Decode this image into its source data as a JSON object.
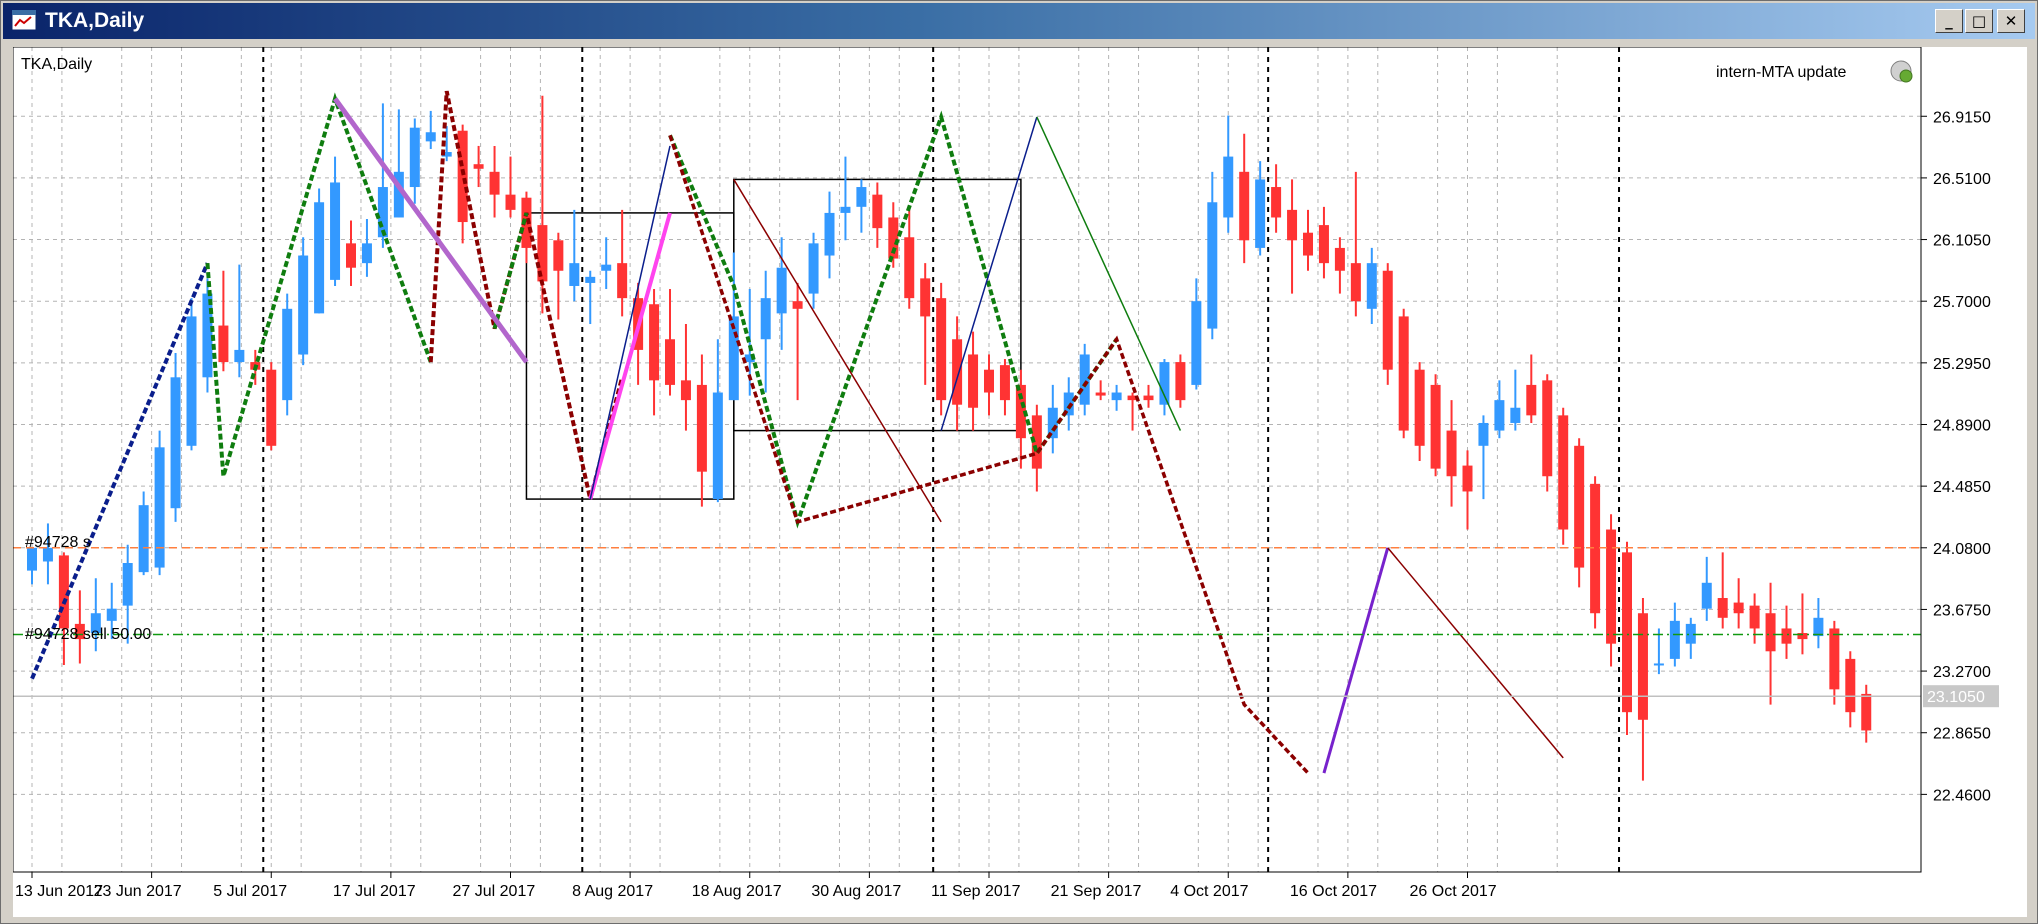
{
  "window": {
    "title": "TKA,Daily"
  },
  "chart_overlay": {
    "symbol_label": "TKA,Daily",
    "expert_label": "intern-MTA update",
    "order_label": "#94728 s",
    "order_line_label": "#94728 sell 50.00",
    "current_price_label": "23.1050"
  },
  "colors": {
    "bull": "#3399ff",
    "bear": "#ff3333",
    "grid": "#b4b4b4",
    "zigzag_dark_blue": "#0a1e8c",
    "zigzag_green": "#0f7d0f",
    "zigzag_dark_red": "#8b0000",
    "trend_purple": "#b266cc",
    "trend_magenta": "#ff44ee",
    "trend_violet": "#7722cc",
    "order_line": "#ff7f3f",
    "sell_line": "#119911",
    "price_line": "#c0c0c0"
  },
  "chart_data": {
    "type": "candlestick",
    "title": "TKA,Daily",
    "y_ticks": [
      "26.9150",
      "26.5100",
      "26.1050",
      "25.7000",
      "25.2950",
      "24.8900",
      "24.4850",
      "24.0800",
      "23.6750",
      "23.2700",
      "22.8650",
      "22.4600"
    ],
    "x_ticks": [
      "13 Jun 2017",
      "23 Jun 2017",
      "5 Jul 2017",
      "17 Jul 2017",
      "27 Jul 2017",
      "8 Aug 2017",
      "18 Aug 2017",
      "30 Aug 2017",
      "11 Sep 2017",
      "21 Sep 2017",
      "4 Oct 2017",
      "16 Oct 2017",
      "26 Oct 2017"
    ],
    "ylim": [
      21.95,
      27.37
    ],
    "grid": true,
    "horizontal_levels": [
      {
        "name": "order",
        "value": 24.08
      },
      {
        "name": "sell",
        "value": 23.51
      },
      {
        "name": "current",
        "value": 23.105
      }
    ],
    "candles": [
      {
        "o": 23.93,
        "h": 24.04,
        "l": 23.84,
        "c": 24.08
      },
      {
        "o": 23.99,
        "h": 24.24,
        "l": 23.84,
        "c": 24.08
      },
      {
        "o": 24.03,
        "h": 24.05,
        "l": 23.31,
        "c": 23.55
      },
      {
        "o": 23.58,
        "h": 23.8,
        "l": 23.32,
        "c": 23.48
      },
      {
        "o": 23.52,
        "h": 23.88,
        "l": 23.4,
        "c": 23.65
      },
      {
        "o": 23.6,
        "h": 23.85,
        "l": 23.48,
        "c": 23.68
      },
      {
        "o": 23.7,
        "h": 24.1,
        "l": 23.45,
        "c": 23.98
      },
      {
        "o": 23.92,
        "h": 24.45,
        "l": 23.9,
        "c": 24.36
      },
      {
        "o": 23.95,
        "h": 24.85,
        "l": 23.9,
        "c": 24.74
      },
      {
        "o": 24.34,
        "h": 25.36,
        "l": 24.25,
        "c": 25.2
      },
      {
        "o": 24.75,
        "h": 25.72,
        "l": 24.72,
        "c": 25.6
      },
      {
        "o": 25.2,
        "h": 25.85,
        "l": 25.1,
        "c": 25.75
      },
      {
        "o": 25.54,
        "h": 25.9,
        "l": 25.24,
        "c": 25.3
      },
      {
        "o": 25.3,
        "h": 25.94,
        "l": 25.2,
        "c": 25.38
      },
      {
        "o": 25.3,
        "h": 25.38,
        "l": 25.15,
        "c": 25.25
      },
      {
        "o": 25.25,
        "h": 25.3,
        "l": 24.72,
        "c": 24.75
      },
      {
        "o": 25.05,
        "h": 25.75,
        "l": 24.95,
        "c": 25.65
      },
      {
        "o": 25.35,
        "h": 26.12,
        "l": 25.28,
        "c": 26.0
      },
      {
        "o": 25.62,
        "h": 26.44,
        "l": 25.62,
        "c": 26.35
      },
      {
        "o": 25.84,
        "h": 26.65,
        "l": 25.8,
        "c": 26.48
      },
      {
        "o": 26.08,
        "h": 26.23,
        "l": 25.8,
        "c": 25.92
      },
      {
        "o": 25.95,
        "h": 26.24,
        "l": 25.86,
        "c": 26.08
      },
      {
        "o": 26.12,
        "h": 27.0,
        "l": 26.05,
        "c": 26.45
      },
      {
        "o": 26.25,
        "h": 26.96,
        "l": 26.25,
        "c": 26.55
      },
      {
        "o": 26.45,
        "h": 26.9,
        "l": 26.34,
        "c": 26.84
      },
      {
        "o": 26.75,
        "h": 26.95,
        "l": 26.7,
        "c": 26.81
      },
      {
        "o": 26.65,
        "h": 26.85,
        "l": 26.62,
        "c": 26.68
      },
      {
        "o": 26.82,
        "h": 26.86,
        "l": 26.08,
        "c": 26.22
      },
      {
        "o": 26.6,
        "h": 26.72,
        "l": 26.45,
        "c": 26.57
      },
      {
        "o": 26.55,
        "h": 26.72,
        "l": 26.25,
        "c": 26.4
      },
      {
        "o": 26.4,
        "h": 26.65,
        "l": 26.25,
        "c": 26.3
      },
      {
        "o": 26.38,
        "h": 26.42,
        "l": 25.95,
        "c": 26.05
      },
      {
        "o": 26.2,
        "h": 27.05,
        "l": 25.62,
        "c": 25.83
      },
      {
        "o": 26.1,
        "h": 26.15,
        "l": 25.58,
        "c": 25.9
      },
      {
        "o": 25.8,
        "h": 26.3,
        "l": 25.7,
        "c": 25.95
      },
      {
        "o": 25.82,
        "h": 25.9,
        "l": 25.55,
        "c": 25.86
      },
      {
        "o": 25.9,
        "h": 26.12,
        "l": 25.78,
        "c": 25.94
      },
      {
        "o": 25.95,
        "h": 26.3,
        "l": 25.6,
        "c": 25.72
      },
      {
        "o": 25.72,
        "h": 25.82,
        "l": 25.15,
        "c": 25.38
      },
      {
        "o": 25.68,
        "h": 25.78,
        "l": 24.95,
        "c": 25.18
      },
      {
        "o": 25.45,
        "h": 25.78,
        "l": 25.08,
        "c": 25.15
      },
      {
        "o": 25.18,
        "h": 25.55,
        "l": 24.85,
        "c": 25.05
      },
      {
        "o": 25.15,
        "h": 25.35,
        "l": 24.35,
        "c": 24.58
      },
      {
        "o": 24.4,
        "h": 25.45,
        "l": 24.38,
        "c": 25.1
      },
      {
        "o": 25.05,
        "h": 26.02,
        "l": 25.05,
        "c": 25.6
      },
      {
        "o": 25.3,
        "h": 25.78,
        "l": 25.08,
        "c": 25.35
      },
      {
        "o": 25.45,
        "h": 25.9,
        "l": 25.1,
        "c": 25.72
      },
      {
        "o": 25.62,
        "h": 26.12,
        "l": 25.38,
        "c": 25.92
      },
      {
        "o": 25.7,
        "h": 25.82,
        "l": 25.05,
        "c": 25.65
      },
      {
        "o": 25.75,
        "h": 26.15,
        "l": 25.65,
        "c": 26.08
      },
      {
        "o": 26.0,
        "h": 26.42,
        "l": 25.85,
        "c": 26.28
      },
      {
        "o": 26.28,
        "h": 26.65,
        "l": 26.1,
        "c": 26.32
      },
      {
        "o": 26.32,
        "h": 26.5,
        "l": 26.15,
        "c": 26.45
      },
      {
        "o": 26.4,
        "h": 26.48,
        "l": 26.05,
        "c": 26.18
      },
      {
        "o": 26.25,
        "h": 26.35,
        "l": 25.92,
        "c": 25.98
      },
      {
        "o": 26.12,
        "h": 26.3,
        "l": 25.65,
        "c": 25.72
      },
      {
        "o": 25.85,
        "h": 25.95,
        "l": 25.15,
        "c": 25.6
      },
      {
        "o": 25.72,
        "h": 25.82,
        "l": 24.95,
        "c": 25.05
      },
      {
        "o": 25.45,
        "h": 25.6,
        "l": 24.85,
        "c": 25.02
      },
      {
        "o": 25.35,
        "h": 25.5,
        "l": 24.85,
        "c": 25.0
      },
      {
        "o": 25.25,
        "h": 25.35,
        "l": 24.95,
        "c": 25.1
      },
      {
        "o": 25.28,
        "h": 25.32,
        "l": 24.95,
        "c": 25.05
      },
      {
        "o": 25.15,
        "h": 25.25,
        "l": 24.6,
        "c": 24.8
      },
      {
        "o": 24.95,
        "h": 25.02,
        "l": 24.45,
        "c": 24.6
      },
      {
        "o": 24.8,
        "h": 25.15,
        "l": 24.7,
        "c": 25.0
      },
      {
        "o": 24.95,
        "h": 25.2,
        "l": 24.85,
        "c": 25.1
      },
      {
        "o": 25.02,
        "h": 25.42,
        "l": 24.95,
        "c": 25.35
      },
      {
        "o": 25.1,
        "h": 25.18,
        "l": 25.05,
        "c": 25.08
      },
      {
        "o": 25.05,
        "h": 25.15,
        "l": 24.98,
        "c": 25.1
      },
      {
        "o": 25.08,
        "h": 25.1,
        "l": 24.85,
        "c": 25.05
      },
      {
        "o": 25.08,
        "h": 25.15,
        "l": 25.0,
        "c": 25.05
      },
      {
        "o": 25.02,
        "h": 25.32,
        "l": 24.95,
        "c": 25.3
      },
      {
        "o": 25.3,
        "h": 25.35,
        "l": 25.0,
        "c": 25.05
      },
      {
        "o": 25.15,
        "h": 25.85,
        "l": 25.12,
        "c": 25.7
      },
      {
        "o": 25.52,
        "h": 26.55,
        "l": 25.45,
        "c": 26.35
      },
      {
        "o": 26.25,
        "h": 26.92,
        "l": 26.15,
        "c": 26.65
      },
      {
        "o": 26.55,
        "h": 26.8,
        "l": 25.95,
        "c": 26.1
      },
      {
        "o": 26.05,
        "h": 26.62,
        "l": 26.0,
        "c": 26.5
      },
      {
        "o": 26.45,
        "h": 26.6,
        "l": 26.15,
        "c": 26.25
      },
      {
        "o": 26.3,
        "h": 26.5,
        "l": 25.75,
        "c": 26.1
      },
      {
        "o": 26.15,
        "h": 26.3,
        "l": 25.9,
        "c": 26.0
      },
      {
        "o": 26.2,
        "h": 26.32,
        "l": 25.85,
        "c": 25.95
      },
      {
        "o": 26.05,
        "h": 26.12,
        "l": 25.75,
        "c": 25.9
      },
      {
        "o": 25.95,
        "h": 26.55,
        "l": 25.6,
        "c": 25.7
      },
      {
        "o": 25.65,
        "h": 26.05,
        "l": 25.55,
        "c": 25.95
      },
      {
        "o": 25.9,
        "h": 25.95,
        "l": 25.15,
        "c": 25.25
      },
      {
        "o": 25.6,
        "h": 25.65,
        "l": 24.8,
        "c": 24.85
      },
      {
        "o": 25.25,
        "h": 25.3,
        "l": 24.65,
        "c": 24.75
      },
      {
        "o": 25.15,
        "h": 25.22,
        "l": 24.55,
        "c": 24.6
      },
      {
        "o": 24.85,
        "h": 25.05,
        "l": 24.35,
        "c": 24.55
      },
      {
        "o": 24.62,
        "h": 24.72,
        "l": 24.2,
        "c": 24.45
      },
      {
        "o": 24.75,
        "h": 24.95,
        "l": 24.4,
        "c": 24.9
      },
      {
        "o": 24.85,
        "h": 25.18,
        "l": 24.8,
        "c": 25.05
      },
      {
        "o": 24.9,
        "h": 25.25,
        "l": 24.85,
        "c": 25.0
      },
      {
        "o": 25.15,
        "h": 25.35,
        "l": 24.9,
        "c": 24.95
      },
      {
        "o": 25.18,
        "h": 25.22,
        "l": 24.45,
        "c": 24.55
      },
      {
        "o": 24.95,
        "h": 25.0,
        "l": 24.1,
        "c": 24.2
      },
      {
        "o": 24.75,
        "h": 24.8,
        "l": 23.82,
        "c": 23.95
      },
      {
        "o": 24.5,
        "h": 24.55,
        "l": 23.55,
        "c": 23.65
      },
      {
        "o": 24.2,
        "h": 24.3,
        "l": 23.3,
        "c": 23.45
      },
      {
        "o": 24.05,
        "h": 24.12,
        "l": 22.85,
        "c": 23.0
      },
      {
        "o": 23.65,
        "h": 23.75,
        "l": 22.55,
        "c": 22.95
      },
      {
        "o": 23.32,
        "h": 23.55,
        "l": 23.25,
        "c": 23.32
      },
      {
        "o": 23.35,
        "h": 23.72,
        "l": 23.3,
        "c": 23.6
      },
      {
        "o": 23.45,
        "h": 23.62,
        "l": 23.35,
        "c": 23.58
      },
      {
        "o": 23.68,
        "h": 24.02,
        "l": 23.6,
        "c": 23.85
      },
      {
        "o": 23.75,
        "h": 24.05,
        "l": 23.55,
        "c": 23.62
      },
      {
        "o": 23.72,
        "h": 23.88,
        "l": 23.55,
        "c": 23.65
      },
      {
        "o": 23.7,
        "h": 23.78,
        "l": 23.45,
        "c": 23.55
      },
      {
        "o": 23.65,
        "h": 23.85,
        "l": 23.05,
        "c": 23.4
      },
      {
        "o": 23.55,
        "h": 23.7,
        "l": 23.35,
        "c": 23.45
      },
      {
        "o": 23.52,
        "h": 23.78,
        "l": 23.38,
        "c": 23.48
      },
      {
        "o": 23.5,
        "h": 23.75,
        "l": 23.42,
        "c": 23.62
      },
      {
        "o": 23.55,
        "h": 23.6,
        "l": 23.05,
        "c": 23.15
      },
      {
        "o": 23.35,
        "h": 23.4,
        "l": 22.9,
        "c": 23.0
      },
      {
        "o": 23.12,
        "h": 23.18,
        "l": 22.8,
        "c": 22.88
      }
    ],
    "zigzag_dark_blue": [
      [
        0,
        23.22
      ],
      [
        11,
        25.95
      ]
    ],
    "zigzag_green_a": [
      [
        11,
        25.95
      ],
      [
        12,
        24.55
      ],
      [
        19,
        27.03
      ],
      [
        25,
        25.3
      ]
    ],
    "zigzag_dark_red": [
      [
        25,
        25.3
      ],
      [
        26,
        27.08
      ],
      [
        29,
        25.52
      ],
      [
        31,
        26.28
      ],
      [
        35,
        24.4
      ],
      [
        37,
        25.2
      ]
    ],
    "zigzag_green_b": [
      [
        29,
        25.52
      ],
      [
        31,
        26.28
      ]
    ],
    "zigzag_green_c": [
      [
        40,
        26.79
      ],
      [
        44,
        25.8
      ],
      [
        48,
        24.25
      ],
      [
        57,
        26.91
      ],
      [
        63,
        24.7
      ],
      [
        68,
        25.45
      ]
    ],
    "zigzag_dark_red_b": [
      [
        40,
        26.79
      ],
      [
        48,
        24.25
      ],
      [
        63,
        24.7
      ],
      [
        68,
        25.45
      ],
      [
        76,
        23.05
      ],
      [
        80,
        22.6
      ]
    ],
    "trend_lines": [
      {
        "name": "trend_purple",
        "points": [
          [
            19,
            27.03
          ],
          [
            31,
            25.3
          ]
        ]
      },
      {
        "name": "trend_magenta",
        "points": [
          [
            35,
            24.4
          ],
          [
            40,
            26.28
          ]
        ]
      },
      {
        "name": "thin_blue_a",
        "points": [
          [
            35,
            24.4
          ],
          [
            40,
            26.72
          ]
        ]
      },
      {
        "name": "thin_red_a",
        "points": [
          [
            44,
            26.5
          ],
          [
            57,
            24.25
          ]
        ]
      },
      {
        "name": "thin_blue_b",
        "points": [
          [
            57,
            24.85
          ],
          [
            63,
            26.91
          ]
        ]
      },
      {
        "name": "thin_green_b",
        "points": [
          [
            63,
            26.91
          ],
          [
            72,
            24.85
          ]
        ]
      },
      {
        "name": "trend_violet",
        "points": [
          [
            81,
            22.6
          ],
          [
            85,
            24.08
          ]
        ]
      },
      {
        "name": "thin_red_b",
        "points": [
          [
            85,
            24.08
          ],
          [
            96,
            22.7
          ]
        ]
      }
    ],
    "rectangles": [
      {
        "name": "rect_jul",
        "x": [
          31,
          44
        ],
        "y": [
          24.4,
          26.28
        ]
      },
      {
        "name": "rect_aug",
        "x": [
          44,
          62
        ],
        "y": [
          24.85,
          26.5
        ]
      }
    ],
    "vertical_separators": [
      14,
      34,
      56,
      77,
      99
    ]
  }
}
